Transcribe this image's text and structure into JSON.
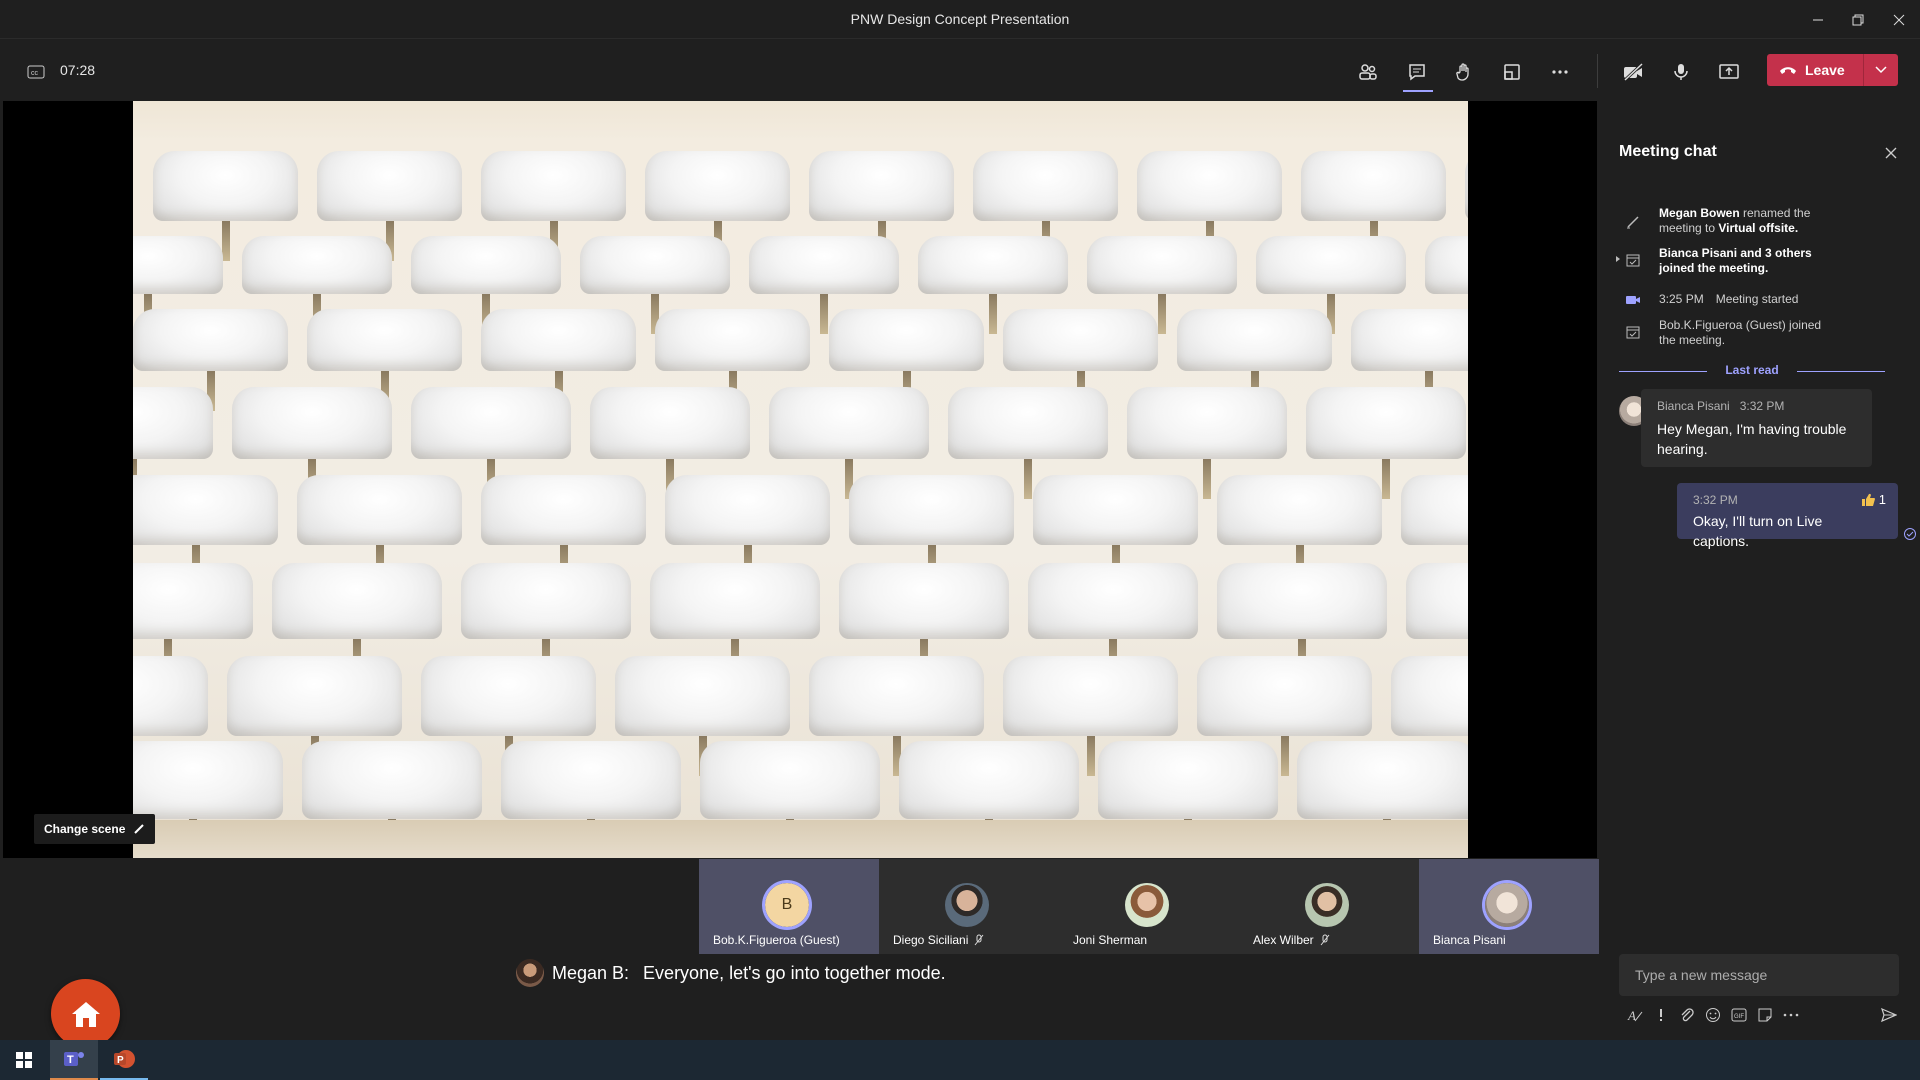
{
  "window": {
    "title": "PNW Design Concept Presentation"
  },
  "toolbar": {
    "timer": "07:28",
    "leave_label": "Leave"
  },
  "stage": {
    "change_scene_label": "Change scene"
  },
  "participants": [
    {
      "name": "Bob.K.Figueroa (Guest)",
      "initial": "B",
      "muted": false,
      "active": true
    },
    {
      "name": "Diego Siciliani",
      "muted": true,
      "active": false
    },
    {
      "name": "Joni Sherman",
      "muted": false,
      "active": false
    },
    {
      "name": "Alex Wilber",
      "muted": true,
      "active": false
    },
    {
      "name": "Bianca Pisani",
      "muted": false,
      "active": true
    }
  ],
  "caption": {
    "speaker": "Megan B:",
    "text": "Everyone, let's go  into together mode."
  },
  "chat": {
    "title": "Meeting chat",
    "events": [
      {
        "bold": "Megan Bowen",
        "text": " renamed the meeting to ",
        "bold2": "Virtual offsite."
      },
      {
        "bold": "Bianca Pisani and 3 others joined the meeting."
      },
      {
        "time": "3:25 PM",
        "text": "Meeting started"
      },
      {
        "text": "Bob.K.Figueroa (Guest) joined the meeting."
      }
    ],
    "last_read": "Last read",
    "messages": [
      {
        "author": "Bianca Pisani",
        "time": "3:32 PM",
        "text": "Hey Megan, I'm having trouble hearing."
      },
      {
        "time": "3:32 PM",
        "text": "Okay, I'll turn on Live captions.",
        "reaction_count": "1"
      }
    ],
    "compose_placeholder": "Type a new message"
  },
  "colors": {
    "accent": "#9ea2ff",
    "leave": "#c4314b",
    "home": "#d9451f"
  }
}
